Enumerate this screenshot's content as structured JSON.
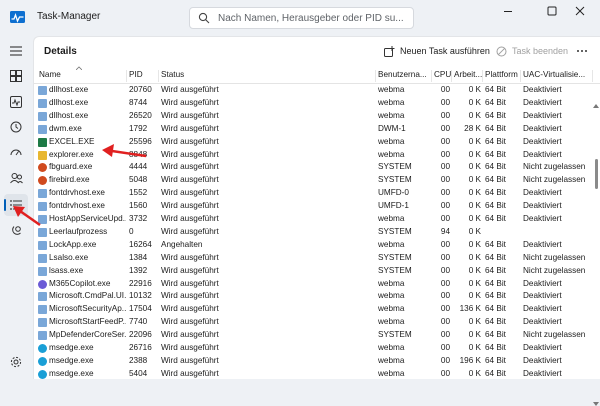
{
  "app": {
    "title": "Task-Manager",
    "brand_color": "#005fb8"
  },
  "search": {
    "placeholder": "Nach Namen, Herausgeber oder PID su..."
  },
  "header": {
    "page_title": "Details",
    "new_task_label": "Neuen Task ausführen",
    "end_task_label": "Task beenden",
    "more_icon": "more-horizontal-icon"
  },
  "nav": [
    {
      "name": "menu",
      "icon": "hamburger-icon"
    },
    {
      "name": "processes",
      "icon": "processes-icon"
    },
    {
      "name": "performance",
      "icon": "performance-icon"
    },
    {
      "name": "app-history",
      "icon": "history-icon"
    },
    {
      "name": "startup-apps",
      "icon": "startup-icon"
    },
    {
      "name": "users",
      "icon": "users-icon"
    },
    {
      "name": "details",
      "icon": "details-list-icon",
      "active": true
    },
    {
      "name": "services",
      "icon": "services-icon"
    },
    {
      "name": "settings",
      "icon": "settings-gear-icon"
    }
  ],
  "table": {
    "columns": [
      "Name",
      "PID",
      "Status",
      "Benutzerna...",
      "CPU",
      "Arbeit...",
      "Plattform",
      "UAC-Virtualisie..."
    ],
    "rows": [
      {
        "name": "dllhost.exe",
        "pid": "20760",
        "status": "Wird ausgeführt",
        "user": "webma",
        "cpu": "00",
        "mem": "0 K",
        "platform": "64 Bit",
        "uac": "Deaktiviert",
        "icon": "exe-icon"
      },
      {
        "name": "dllhost.exe",
        "pid": "8744",
        "status": "Wird ausgeführt",
        "user": "webma",
        "cpu": "00",
        "mem": "0 K",
        "platform": "64 Bit",
        "uac": "Deaktiviert",
        "icon": "exe-icon"
      },
      {
        "name": "dllhost.exe",
        "pid": "26520",
        "status": "Wird ausgeführt",
        "user": "webma",
        "cpu": "00",
        "mem": "0 K",
        "platform": "64 Bit",
        "uac": "Deaktiviert",
        "icon": "exe-icon"
      },
      {
        "name": "dwm.exe",
        "pid": "1792",
        "status": "Wird ausgeführt",
        "user": "DWM-1",
        "cpu": "00",
        "mem": "28 K",
        "platform": "64 Bit",
        "uac": "Deaktiviert",
        "icon": "exe-icon"
      },
      {
        "name": "EXCEL.EXE",
        "pid": "25596",
        "status": "Wird ausgeführt",
        "user": "webma",
        "cpu": "00",
        "mem": "0 K",
        "platform": "64 Bit",
        "uac": "Deaktiviert",
        "icon": "excel-icon"
      },
      {
        "name": "explorer.exe",
        "pid": "8848",
        "status": "Wird ausgeführt",
        "user": "webma",
        "cpu": "00",
        "mem": "0 K",
        "platform": "64 Bit",
        "uac": "Deaktiviert",
        "icon": "folder-icon"
      },
      {
        "name": "fbguard.exe",
        "pid": "4444",
        "status": "Wird ausgeführt",
        "user": "SYSTEM",
        "cpu": "00",
        "mem": "0 K",
        "platform": "64 Bit",
        "uac": "Nicht zugelassen",
        "icon": "firebird-icon"
      },
      {
        "name": "firebird.exe",
        "pid": "5048",
        "status": "Wird ausgeführt",
        "user": "SYSTEM",
        "cpu": "00",
        "mem": "0 K",
        "platform": "64 Bit",
        "uac": "Nicht zugelassen",
        "icon": "firebird-icon"
      },
      {
        "name": "fontdrvhost.exe",
        "pid": "1552",
        "status": "Wird ausgeführt",
        "user": "UMFD-0",
        "cpu": "00",
        "mem": "0 K",
        "platform": "64 Bit",
        "uac": "Deaktiviert",
        "icon": "exe-icon"
      },
      {
        "name": "fontdrvhost.exe",
        "pid": "1560",
        "status": "Wird ausgeführt",
        "user": "UMFD-1",
        "cpu": "00",
        "mem": "0 K",
        "platform": "64 Bit",
        "uac": "Deaktiviert",
        "icon": "exe-icon"
      },
      {
        "name": "HostAppServiceUpd...",
        "pid": "3732",
        "status": "Wird ausgeführt",
        "user": "webma",
        "cpu": "00",
        "mem": "0 K",
        "platform": "64 Bit",
        "uac": "Deaktiviert",
        "icon": "exe-icon"
      },
      {
        "name": "Leerlaufprozess",
        "pid": "0",
        "status": "Wird ausgeführt",
        "user": "SYSTEM",
        "cpu": "94",
        "mem": "0 K",
        "platform": "",
        "uac": "",
        "icon": "exe-icon"
      },
      {
        "name": "LockApp.exe",
        "pid": "16264",
        "status": "Angehalten",
        "user": "webma",
        "cpu": "00",
        "mem": "0 K",
        "platform": "64 Bit",
        "uac": "Deaktiviert",
        "icon": "exe-icon"
      },
      {
        "name": "Lsalso.exe",
        "pid": "1384",
        "status": "Wird ausgeführt",
        "user": "SYSTEM",
        "cpu": "00",
        "mem": "0 K",
        "platform": "64 Bit",
        "uac": "Nicht zugelassen",
        "icon": "exe-icon"
      },
      {
        "name": "lsass.exe",
        "pid": "1392",
        "status": "Wird ausgeführt",
        "user": "SYSTEM",
        "cpu": "00",
        "mem": "0 K",
        "platform": "64 Bit",
        "uac": "Nicht zugelassen",
        "icon": "exe-icon"
      },
      {
        "name": "M365Copilot.exe",
        "pid": "22916",
        "status": "Wird ausgeführt",
        "user": "webma",
        "cpu": "00",
        "mem": "0 K",
        "platform": "64 Bit",
        "uac": "Deaktiviert",
        "icon": "copilot-icon"
      },
      {
        "name": "Microsoft.CmdPal.UI...",
        "pid": "10132",
        "status": "Wird ausgeführt",
        "user": "webma",
        "cpu": "00",
        "mem": "0 K",
        "platform": "64 Bit",
        "uac": "Deaktiviert",
        "icon": "exe-icon"
      },
      {
        "name": "MicrosoftSecurityAp...",
        "pid": "17504",
        "status": "Wird ausgeführt",
        "user": "webma",
        "cpu": "00",
        "mem": "136 K",
        "platform": "64 Bit",
        "uac": "Deaktiviert",
        "icon": "exe-icon"
      },
      {
        "name": "MicrosoftStartFeedP...",
        "pid": "7740",
        "status": "Wird ausgeführt",
        "user": "webma",
        "cpu": "00",
        "mem": "0 K",
        "platform": "64 Bit",
        "uac": "Deaktiviert",
        "icon": "exe-icon"
      },
      {
        "name": "MpDefenderCoreSer...",
        "pid": "22096",
        "status": "Wird ausgeführt",
        "user": "SYSTEM",
        "cpu": "00",
        "mem": "0 K",
        "platform": "64 Bit",
        "uac": "Nicht zugelassen",
        "icon": "exe-icon"
      },
      {
        "name": "msedge.exe",
        "pid": "26716",
        "status": "Wird ausgeführt",
        "user": "webma",
        "cpu": "00",
        "mem": "0 K",
        "platform": "64 Bit",
        "uac": "Deaktiviert",
        "icon": "edge-icon"
      },
      {
        "name": "msedge.exe",
        "pid": "2388",
        "status": "Wird ausgeführt",
        "user": "webma",
        "cpu": "00",
        "mem": "196 K",
        "platform": "64 Bit",
        "uac": "Deaktiviert",
        "icon": "edge-icon"
      },
      {
        "name": "msedge.exe",
        "pid": "5404",
        "status": "Wird ausgeführt",
        "user": "webma",
        "cpu": "00",
        "mem": "0 K",
        "platform": "64 Bit",
        "uac": "Deaktiviert",
        "icon": "edge-icon"
      }
    ]
  },
  "annotation_color": "#e02020"
}
